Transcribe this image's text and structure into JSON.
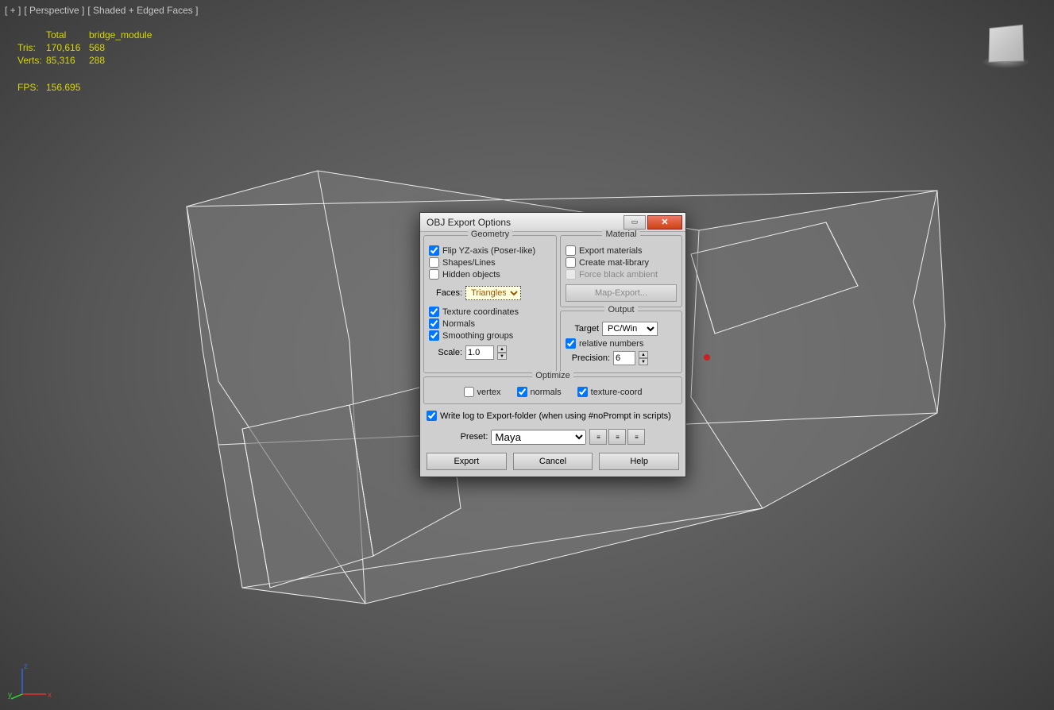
{
  "viewport": {
    "plus": "[ + ]",
    "view": "[ Perspective ]",
    "shading": "[ Shaded + Edged Faces ]"
  },
  "stats": {
    "col1_hdr": "Total",
    "col2_hdr": "bridge_module",
    "rows": [
      {
        "label": "Tris:",
        "c1": "170,616",
        "c2": "568"
      },
      {
        "label": "Verts:",
        "c1": "85,316",
        "c2": "288"
      }
    ],
    "fps_label": "FPS:",
    "fps_value": "156.695"
  },
  "dialog": {
    "title": "OBJ Export Options",
    "geometry": {
      "legend": "Geometry",
      "flip": "Flip YZ-axis (Poser-like)",
      "shapes": "Shapes/Lines",
      "hidden": "Hidden objects",
      "faces_label": "Faces:",
      "faces_value": "Triangles",
      "tex": "Texture coordinates",
      "norm": "Normals",
      "smooth": "Smoothing groups",
      "scale_label": "Scale:",
      "scale_value": "1.0"
    },
    "material": {
      "legend": "Material",
      "export": "Export materials",
      "create": "Create mat-library",
      "force": "Force black ambient",
      "map_btn": "Map-Export..."
    },
    "output": {
      "legend": "Output",
      "target_label": "Target",
      "target_value": "PC/Win",
      "relative": "relative numbers",
      "precision_label": "Precision:",
      "precision_value": "6"
    },
    "optimize": {
      "legend": "Optimize",
      "vertex": "vertex",
      "normals": "normals",
      "texcoord": "texture-coord"
    },
    "log": "Write log to Export-folder (when using #noPrompt in scripts)",
    "preset_label": "Preset:",
    "preset_value": "Maya",
    "buttons": {
      "export": "Export",
      "cancel": "Cancel",
      "help": "Help"
    }
  },
  "axis": {
    "x": "x",
    "y": "y",
    "z": "z"
  }
}
